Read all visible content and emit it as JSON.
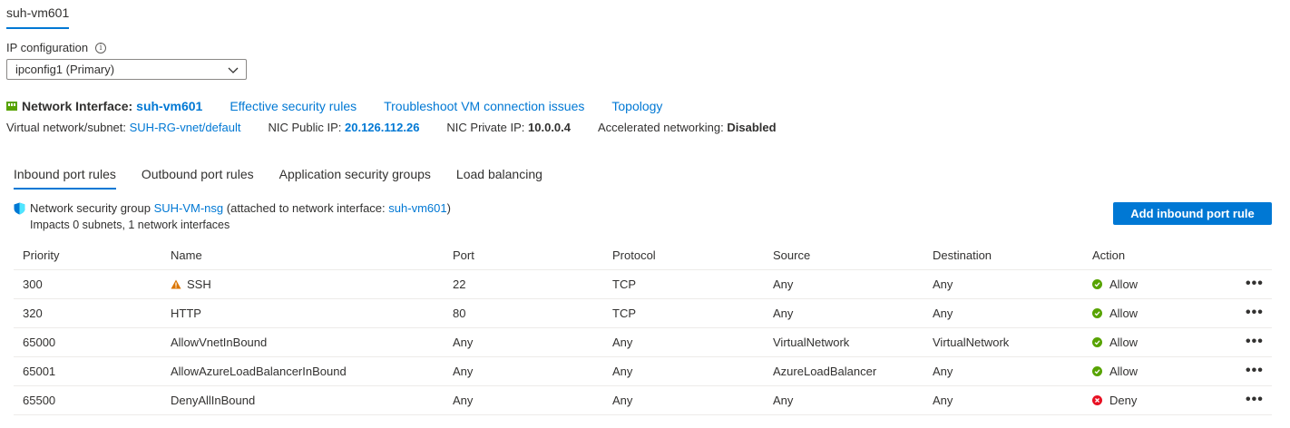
{
  "top_tab": {
    "label": "suh-vm601"
  },
  "ip_config": {
    "label": "IP configuration",
    "selected": "ipconfig1 (Primary)"
  },
  "nic": {
    "title": "Network Interface:",
    "name": "suh-vm601",
    "links": [
      "Effective security rules",
      "Troubleshoot VM connection issues",
      "Topology"
    ]
  },
  "info": {
    "vnet_label": "Virtual network/subnet:",
    "vnet_value": "SUH-RG-vnet/default",
    "public_ip_label": "NIC Public IP:",
    "public_ip_value": "20.126.112.26",
    "private_ip_label": "NIC Private IP:",
    "private_ip_value": "10.0.0.4",
    "accel_label": "Accelerated networking:",
    "accel_value": "Disabled"
  },
  "tabs": [
    "Inbound port rules",
    "Outbound port rules",
    "Application security groups",
    "Load balancing"
  ],
  "nsg": {
    "prefix": "Network security group",
    "name": "SUH-VM-nsg",
    "attached_prefix": "(attached to network interface:",
    "attached_name": "suh-vm601",
    "attached_suffix": ")",
    "impacts": "Impacts 0 subnets, 1 network interfaces"
  },
  "add_button": "Add inbound port rule",
  "table": {
    "headers": {
      "priority": "Priority",
      "name": "Name",
      "port": "Port",
      "protocol": "Protocol",
      "source": "Source",
      "destination": "Destination",
      "action": "Action"
    },
    "rows": [
      {
        "priority": "300",
        "name": "SSH",
        "warning": true,
        "port": "22",
        "protocol": "TCP",
        "source": "Any",
        "destination": "Any",
        "action": "Allow"
      },
      {
        "priority": "320",
        "name": "HTTP",
        "warning": false,
        "port": "80",
        "protocol": "TCP",
        "source": "Any",
        "destination": "Any",
        "action": "Allow"
      },
      {
        "priority": "65000",
        "name": "AllowVnetInBound",
        "warning": false,
        "port": "Any",
        "protocol": "Any",
        "source": "VirtualNetwork",
        "destination": "VirtualNetwork",
        "action": "Allow"
      },
      {
        "priority": "65001",
        "name": "AllowAzureLoadBalancerInBound",
        "warning": false,
        "port": "Any",
        "protocol": "Any",
        "source": "AzureLoadBalancer",
        "destination": "Any",
        "action": "Allow"
      },
      {
        "priority": "65500",
        "name": "DenyAllInBound",
        "warning": false,
        "port": "Any",
        "protocol": "Any",
        "source": "Any",
        "destination": "Any",
        "action": "Deny"
      }
    ],
    "more_glyph": "•••"
  },
  "colors": {
    "accent": "#0078d4",
    "allow": "#57a300",
    "deny": "#e81123",
    "warning": "#db7500"
  },
  "icons": {
    "ip_info": "info-icon",
    "dropdown": "chevron-down-icon",
    "nic": "network-interface-icon",
    "nsg": "shield-icon",
    "warning": "warning-icon",
    "allow": "check-circle-icon",
    "deny": "error-circle-icon",
    "more": "more-icon"
  }
}
